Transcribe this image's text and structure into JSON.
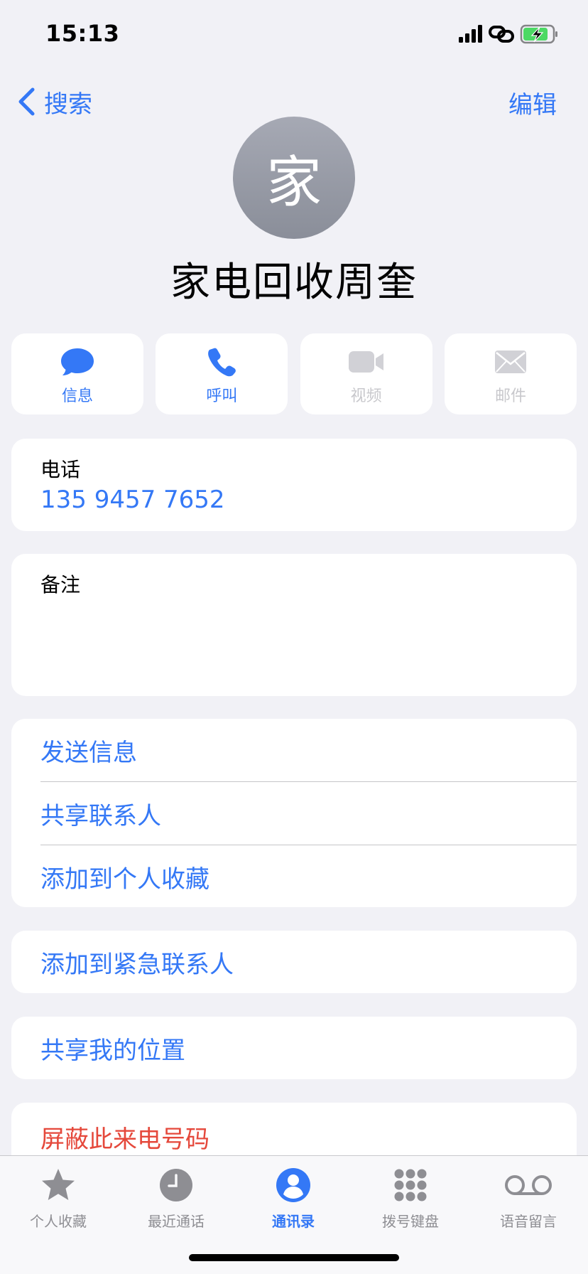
{
  "status": {
    "time": "15:13"
  },
  "nav": {
    "back_label": "搜索",
    "edit_label": "编辑"
  },
  "contact": {
    "avatar_initial": "家",
    "name": "家电回收周奎"
  },
  "actions": [
    {
      "label": "信息",
      "icon": "message-bubble-icon",
      "enabled": true
    },
    {
      "label": "呼叫",
      "icon": "phone-icon",
      "enabled": true
    },
    {
      "label": "视频",
      "icon": "video-camera-icon",
      "enabled": false
    },
    {
      "label": "邮件",
      "icon": "envelope-icon",
      "enabled": false
    }
  ],
  "phone": {
    "label": "电话",
    "value": "135 9457 7652"
  },
  "notes": {
    "label": "备注"
  },
  "options": [
    {
      "label": "发送信息"
    },
    {
      "label": "共享联系人"
    },
    {
      "label": "添加到个人收藏"
    }
  ],
  "emergency": {
    "label": "添加到紧急联系人"
  },
  "share_location": {
    "label": "共享我的位置"
  },
  "block": {
    "label": "屏蔽此来电号码"
  },
  "tabs": [
    {
      "label": "个人收藏",
      "icon": "star-icon",
      "active": false
    },
    {
      "label": "最近通话",
      "icon": "clock-icon",
      "active": false
    },
    {
      "label": "通讯录",
      "icon": "person-circle-icon",
      "active": true
    },
    {
      "label": "拨号键盘",
      "icon": "keypad-icon",
      "active": false
    },
    {
      "label": "语音留言",
      "icon": "voicemail-icon",
      "active": false
    }
  ],
  "colors": {
    "accent": "#3478F6",
    "destructive": "#E5483B",
    "background": "#F1F1F6",
    "inactive": "#8E8E93"
  }
}
